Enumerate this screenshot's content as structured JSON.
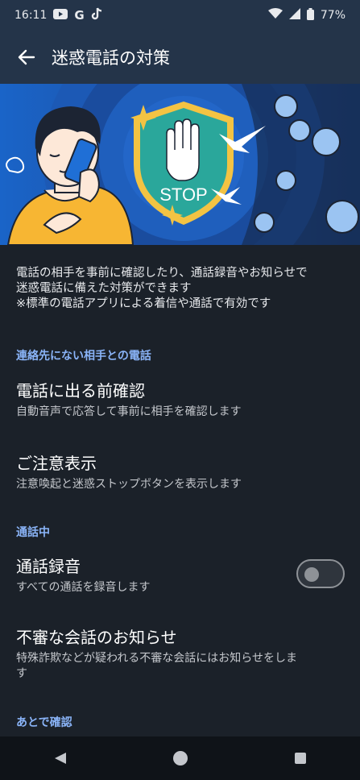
{
  "status": {
    "time": "16:11",
    "battery": "77%",
    "icons": [
      "youtube-icon",
      "google-icon",
      "tiktok-icon",
      "wifi-icon",
      "signal-icon",
      "battery-icon"
    ]
  },
  "appbar": {
    "title": "迷惑電話の対策"
  },
  "hero": {
    "stop_text": "STOP"
  },
  "description": {
    "line1": "電話の相手を事前に確認したり、通話録音やお知らせで",
    "line2": "迷惑電話に備えた対策ができます",
    "line3": "※標準の電話アプリによる着信や通話で有効です"
  },
  "sections": {
    "unknown_calls": "連絡先にない相手との電話",
    "in_call": "通話中",
    "later": "あとで確認"
  },
  "items": {
    "screen": {
      "title": "電話に出る前確認",
      "subtitle": "自動音声で応答して事前に相手を確認します"
    },
    "caution": {
      "title": "ご注意表示",
      "subtitle": "注意喚起と迷惑ストップボタンを表示します"
    },
    "record": {
      "title": "通話録音",
      "subtitle": "すべての通話を録音します",
      "enabled": false
    },
    "suspicious": {
      "title": "不審な会話のお知らせ",
      "subtitle_line1": "特殊詐欺などが疑われる不審な会話にはお知らせをしま",
      "subtitle_line2": "す"
    }
  },
  "colors": {
    "background": "#1b2129",
    "appbar": "#243449",
    "accent": "#8ab4f8",
    "shield": "#2aa79b",
    "shield_border": "#f3c343"
  }
}
